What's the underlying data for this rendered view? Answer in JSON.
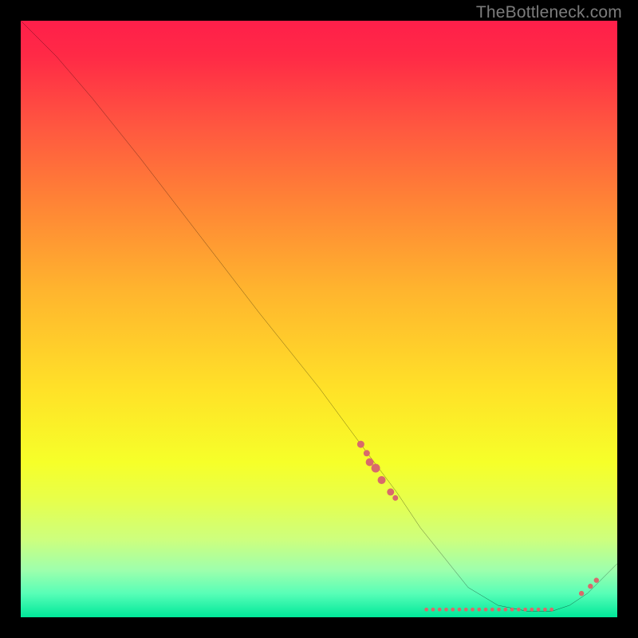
{
  "watermark": "TheBottleneck.com",
  "chart_data": {
    "type": "line",
    "title": "",
    "xlabel": "",
    "ylabel": "",
    "xlim": [
      0,
      100
    ],
    "ylim": [
      0,
      100
    ],
    "grid": false,
    "legend": false,
    "series": [
      {
        "name": "curve",
        "x": [
          0,
          6,
          12,
          20,
          30,
          40,
          50,
          57,
          63,
          67,
          71,
          75,
          80,
          85,
          89,
          92,
          95,
          100
        ],
        "y": [
          100,
          94,
          87,
          77,
          64,
          51,
          38.5,
          29,
          21,
          15,
          10,
          5,
          2,
          1,
          1,
          2,
          4,
          9
        ]
      }
    ],
    "points": {
      "name": "markers",
      "color": "#d86a6b",
      "coords": [
        {
          "x": 57,
          "y": 29,
          "r": 4.5
        },
        {
          "x": 58,
          "y": 27.5,
          "r": 4
        },
        {
          "x": 58.5,
          "y": 26,
          "r": 5
        },
        {
          "x": 59.5,
          "y": 25,
          "r": 5.5
        },
        {
          "x": 60.5,
          "y": 23,
          "r": 5
        },
        {
          "x": 62,
          "y": 21,
          "r": 4.5
        },
        {
          "x": 62.8,
          "y": 20,
          "r": 3.5
        },
        {
          "x": 94,
          "y": 4,
          "r": 3.2
        },
        {
          "x": 95.5,
          "y": 5.2,
          "r": 3.2
        },
        {
          "x": 96.5,
          "y": 6.2,
          "r": 3.2
        }
      ],
      "bottom_row": {
        "x_start": 68,
        "x_end": 89,
        "y": 1.3,
        "count": 20,
        "r": 2.4
      }
    }
  }
}
